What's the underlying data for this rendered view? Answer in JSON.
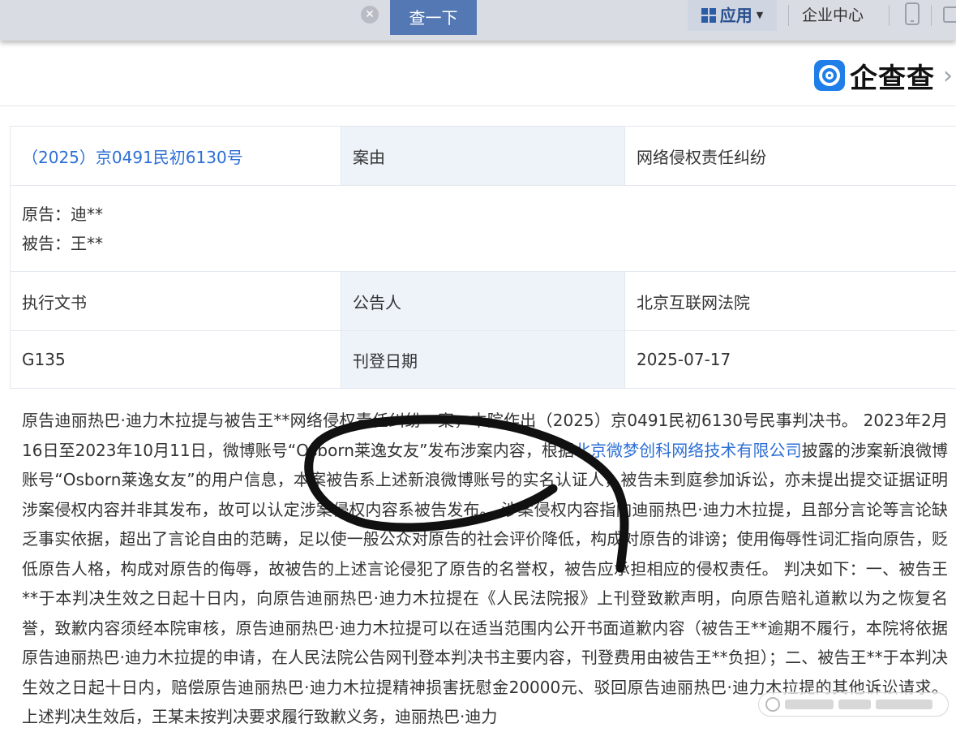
{
  "topbar": {
    "search_button": "查一下",
    "apps_label": "应用",
    "enterprise_center": "企业中心"
  },
  "brand": {
    "name": "企查查"
  },
  "record": {
    "case_number": "（2025）京0491民初6130号",
    "cause_label": "案由",
    "cause_value": "网络侵权责任纠纷",
    "plaintiff": "原告：迪**",
    "defendant": "被告：王**",
    "doc_type": "执行文书",
    "announcer_label": "公告人",
    "announcer_value": "北京互联网法院",
    "code": "G135",
    "publish_date_label": "刊登日期",
    "publish_date_value": "2025-07-17"
  },
  "content": {
    "part1": "原告迪丽热巴·迪力木拉提与被告王**网络侵权责任纠纷一案，本院作出（2025）京0491民初6130号民事判决书。 2023年2月16日至2023年10月11日，微博账号“Osborn莱逸女友”发布涉案内容，根据",
    "company_link": "北京微梦创科网络技术有限公司",
    "part2": "披露的涉案新浪微博账号“Osborn莱逸女友”的用户信息，本案被告系上述新浪微博账号的实名认证人，被告未到庭参加诉讼，亦未提出提交证据证明涉案侵权内容并非其发布，故可以认定涉案侵权内容系被告发布。 涉案侵权内容指向迪丽热巴·迪力木拉提，且部分言论等言论缺乏事实依据，超出了言论自由的范畴，足以使一般公众对原告的社会评价降低，构成对原告的诽谤；使用侮辱性词汇指向原告，贬低原告人格，构成对原告的侮辱，故被告的上述言论侵犯了原告的名誉权，被告应承担相应的侵权责任。 判决如下：一、被告王**于本判决生效之日起十日内，向原告迪丽热巴·迪力木拉提在《人民法院报》上刊登致歉声明，向原告赔礼道歉以为之恢复名誉，致歉内容须经本院审核，原告迪丽热巴·迪力木拉提可以在适当范围内公开书面道歉内容（被告王**逾期不履行，本院将依据原告迪丽热巴·迪力木拉提的申请，在人民法院公告网刊登本判决书主要内容，刊登费用由被告王**负担）；二、被告王**于本判决生效之日起十日内，赔偿原告迪丽热巴·迪力木拉提精神损害抚慰金20000元、",
    "part3": "驳回原告迪丽热巴·迪力木拉提的其他诉讼请求。 上述判决生效后，王某未按判决要求履行致歉义务，迪丽热巴·迪力"
  },
  "colors": {
    "topbar_bg": "#d9dce3",
    "search_button_bg": "#5478b4",
    "link": "#2d6fd6",
    "label_cell_bg": "#eef3fa",
    "brand_blue": "#1f7ee8"
  },
  "icons": [
    "clear-search-icon",
    "apps-grid-icon",
    "chevron-down-icon",
    "phone-icon",
    "window-icon",
    "brand-logo-icon",
    "chevron-right-icon"
  ]
}
